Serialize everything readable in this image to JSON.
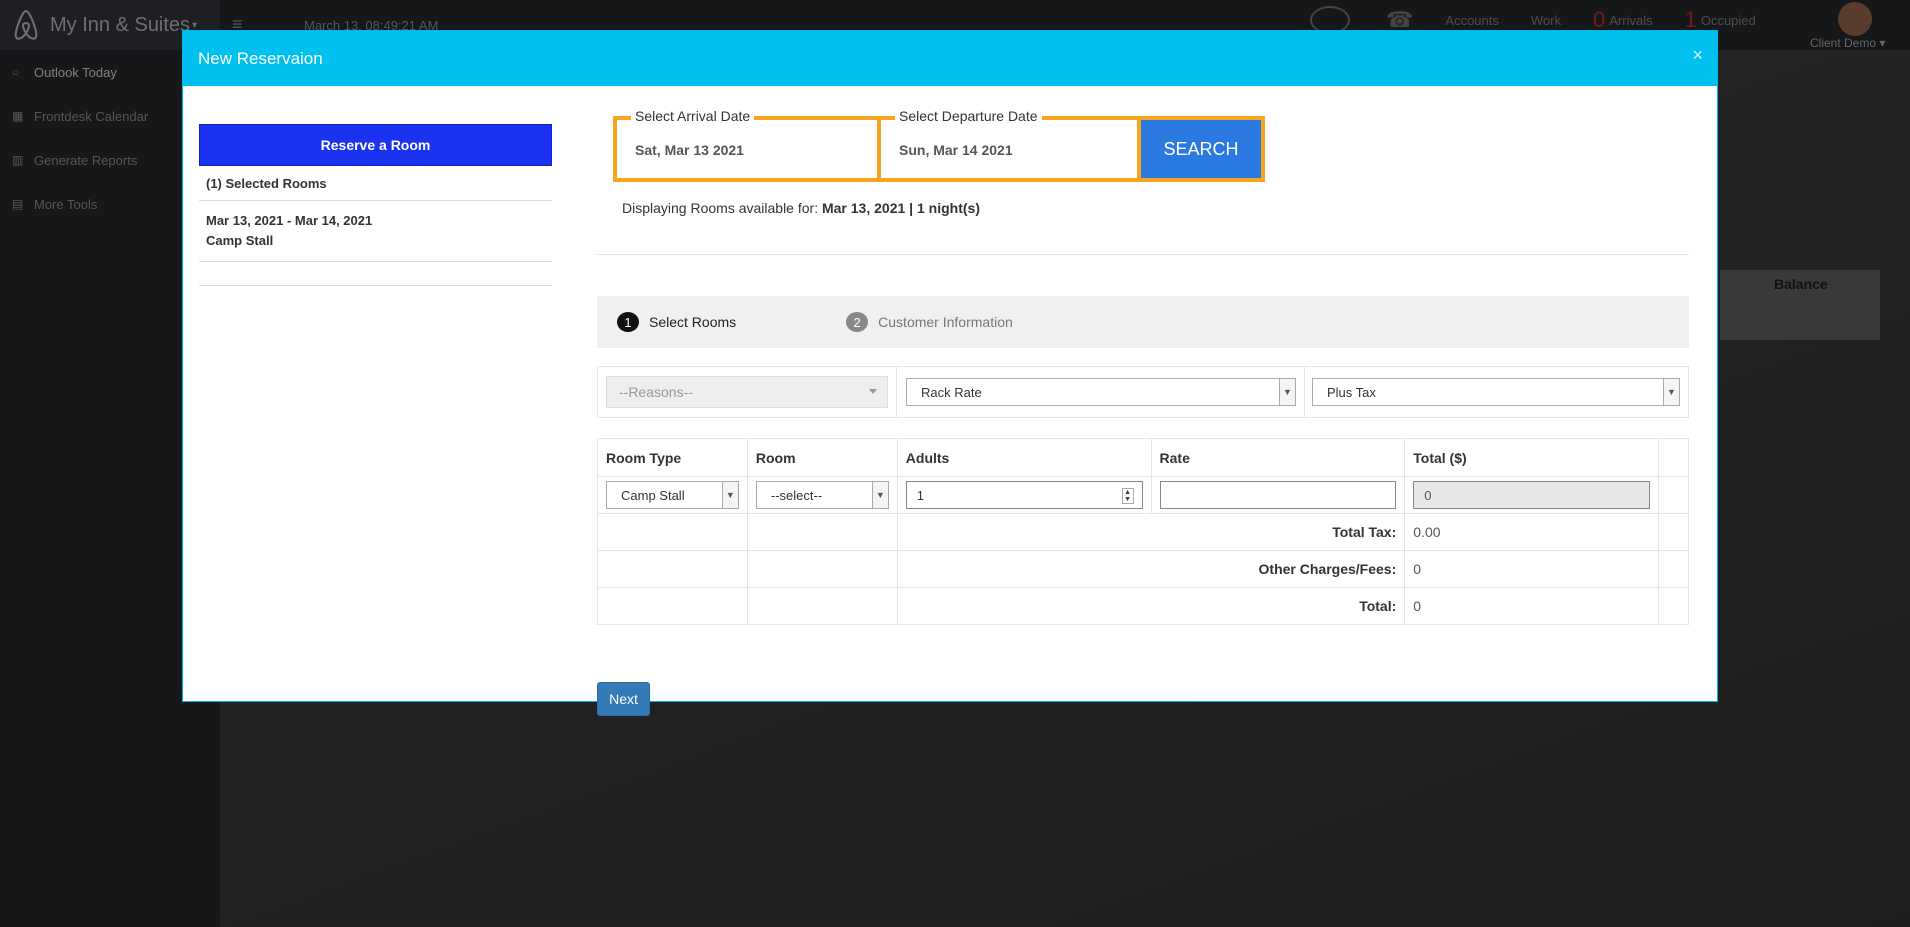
{
  "app": {
    "brand": "My Inn & Suites",
    "clock": "March 13, 08:49:21 AM",
    "topbar_links": [
      "Accounts",
      "Work"
    ],
    "arrivals": {
      "count": "0",
      "label": "Arrivals"
    },
    "occupied": {
      "count": "1",
      "label": "Occupied"
    },
    "user": "Client Demo"
  },
  "sidebar": {
    "items": [
      {
        "label": "Outlook Today",
        "icon": "circle-icon"
      },
      {
        "label": "Frontdesk Calendar",
        "icon": "calendar-icon"
      },
      {
        "label": "Generate Reports",
        "icon": "bar-chart-icon"
      },
      {
        "label": "More Tools",
        "icon": "table-icon"
      }
    ]
  },
  "background": {
    "balance_header": "Balance"
  },
  "modal": {
    "title": "New Reservaion",
    "close": "×",
    "left": {
      "reserve_button": "Reserve a Room",
      "selected_count": "(1) Selected Rooms",
      "selected_dates": "Mar 13, 2021 - Mar 14, 2021",
      "selected_type": "Camp Stall"
    },
    "search": {
      "arrival_label": "Select Arrival Date",
      "arrival_value": "Sat, Mar 13 2021",
      "departure_label": "Select Departure Date",
      "departure_value": "Sun, Mar 14 2021",
      "button": "SEARCH"
    },
    "availability": {
      "prefix": "Displaying Rooms available for: ",
      "date": "Mar 13, 2021",
      "sep": " | ",
      "nights": "1 night(s)"
    },
    "steps": [
      {
        "num": "1",
        "label": "Select Rooms"
      },
      {
        "num": "2",
        "label": "Customer Information"
      }
    ],
    "filters": {
      "reasons_placeholder": "--Reasons--",
      "rate": "Rack Rate",
      "tax": "Plus Tax"
    },
    "table": {
      "headers": [
        "Room Type",
        "Room",
        "Adults",
        "Rate",
        "Total ($)"
      ],
      "row": {
        "room_type": "Camp Stall",
        "room": "--select--",
        "adults": "1",
        "rate": "",
        "total": "0"
      },
      "summary": [
        {
          "label": "Total Tax:",
          "value": "0.00"
        },
        {
          "label": "Other Charges/Fees:",
          "value": "0"
        },
        {
          "label": "Total:",
          "value": "0"
        }
      ]
    },
    "next_button": "Next"
  }
}
